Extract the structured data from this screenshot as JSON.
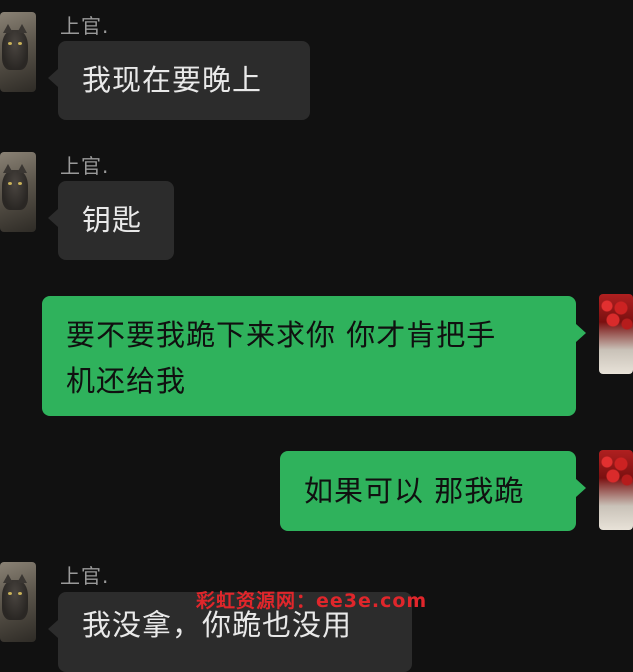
{
  "messages": [
    {
      "sender": "上官.",
      "direction": "incoming",
      "text": "我现在要晚上"
    },
    {
      "sender": "上官.",
      "direction": "incoming",
      "text": "钥匙"
    },
    {
      "sender": "",
      "direction": "outgoing",
      "text_line1": "要不要我跪下来求你 你才肯把手",
      "text_line2": "机还给我"
    },
    {
      "sender": "",
      "direction": "outgoing",
      "text": "如果可以 那我跪"
    },
    {
      "sender": "上官.",
      "direction": "incoming",
      "text": "我没拿，你跪也没用"
    }
  ],
  "watermark": "彩虹资源网：ee3e.com",
  "colors": {
    "background": "#111111",
    "incoming_bubble": "#2c2c2c",
    "outgoing_bubble": "#2fb25c",
    "sender_name": "#9a9a9a",
    "watermark": "#e0262b"
  },
  "icons": {
    "contact_avatar": "cat-photo-avatar",
    "self_avatar": "rose-photo-avatar"
  }
}
